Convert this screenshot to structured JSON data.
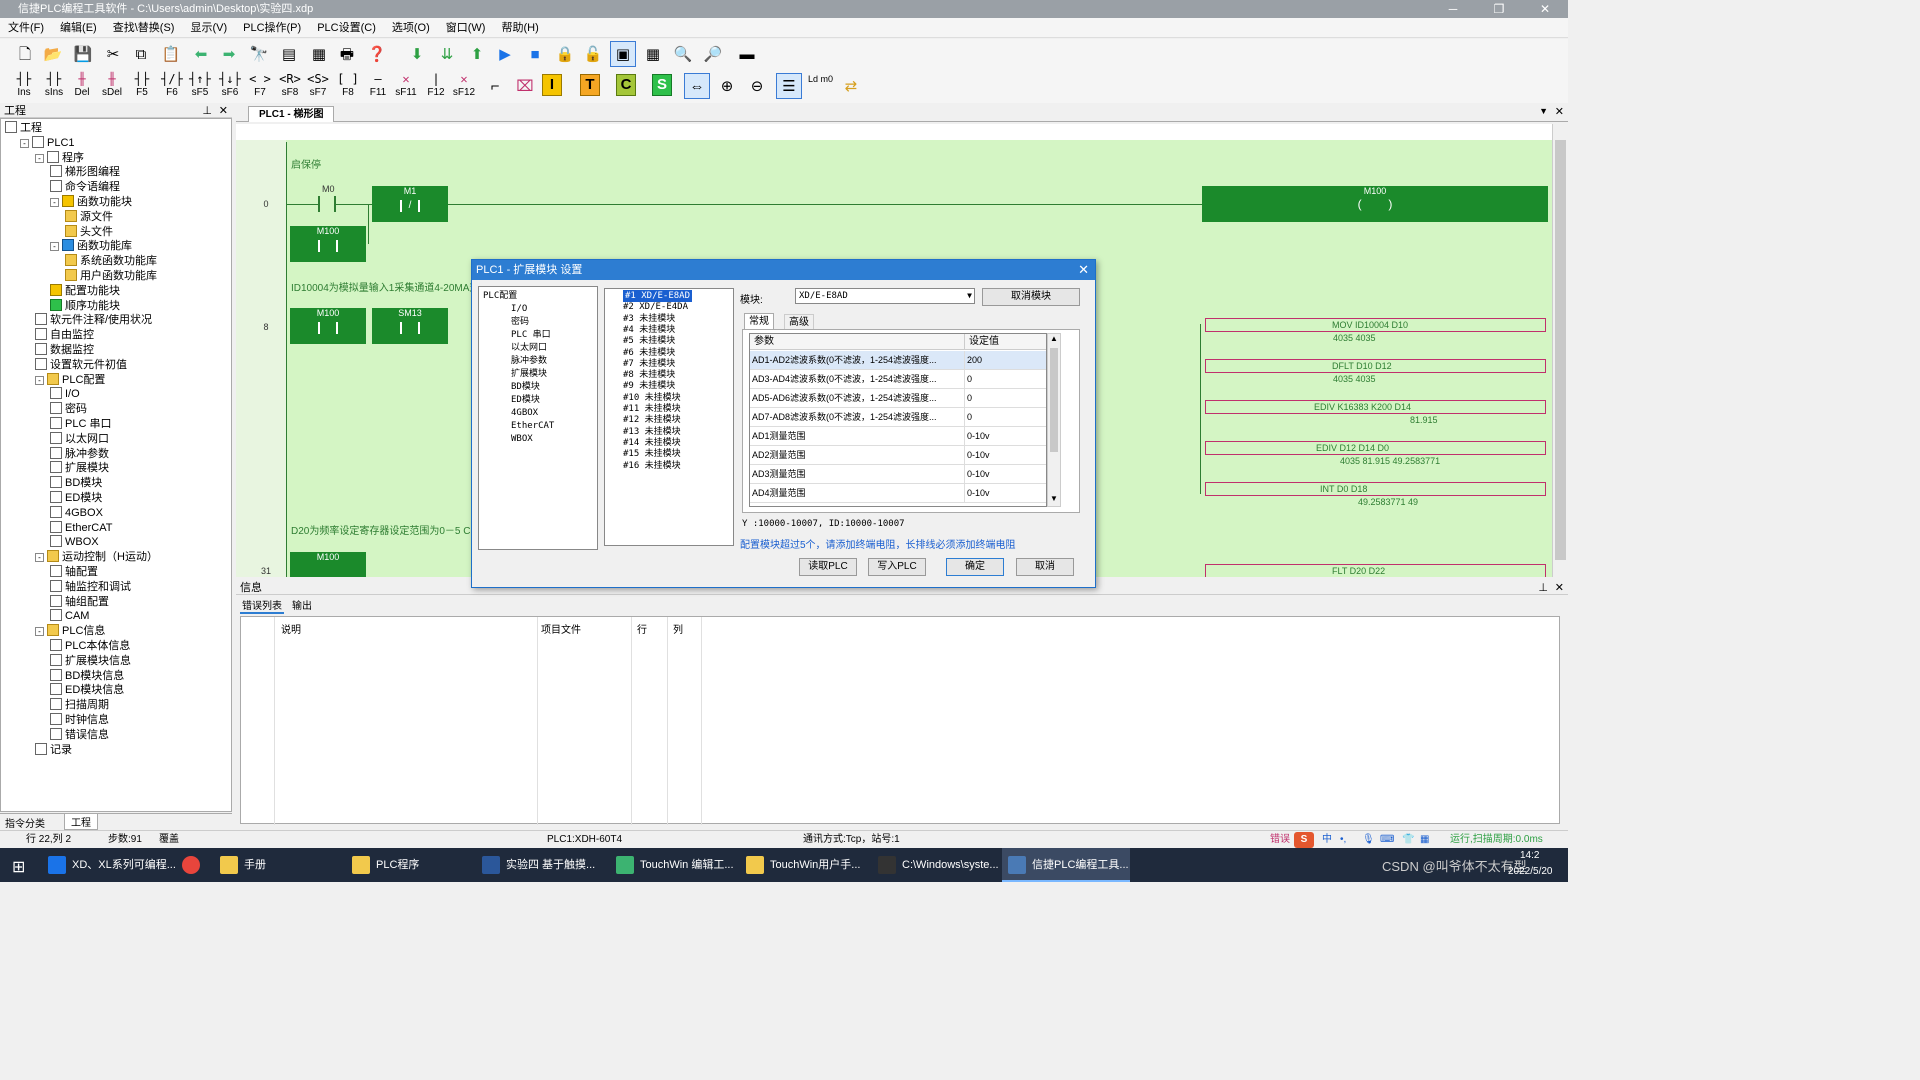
{
  "window": {
    "title": "信捷PLC编程工具软件 - C:\\Users\\admin\\Desktop\\实验四.xdp"
  },
  "menu": [
    "文件(F)",
    "编辑(E)",
    "查找\\替换(S)",
    "显示(V)",
    "PLC操作(P)",
    "PLC设置(C)",
    "选项(O)",
    "窗口(W)",
    "帮助(H)"
  ],
  "ladder_toolbar": [
    {
      "glyph": "┤├",
      "key": "Ins"
    },
    {
      "glyph": "┤├",
      "key": "sIns"
    },
    {
      "glyph": "╫",
      "key": "Del"
    },
    {
      "glyph": "╫",
      "key": "sDel"
    },
    {
      "glyph": "┤├",
      "key": "F5"
    },
    {
      "glyph": "┤/├",
      "key": "F6"
    },
    {
      "glyph": "┤↑├",
      "key": "sF5"
    },
    {
      "glyph": "┤↓├",
      "key": "sF6"
    },
    {
      "glyph": "< >",
      "key": "F7"
    },
    {
      "glyph": "<R>",
      "key": "sF8"
    },
    {
      "glyph": "<S>",
      "key": "sF7"
    },
    {
      "glyph": "[ ]",
      "key": "F8"
    },
    {
      "glyph": "—",
      "key": "F11"
    },
    {
      "glyph": "✕",
      "key": "sF11"
    },
    {
      "glyph": "|",
      "key": "F12"
    },
    {
      "glyph": "✕",
      "key": "sF12"
    }
  ],
  "ladder_toolbar_extra": {
    "ldm": "Ld m0"
  },
  "project_panel": {
    "header": "工程",
    "tree": [
      {
        "label": "工程",
        "level": 0,
        "icon": "project"
      },
      {
        "label": "PLC1",
        "level": 1,
        "icon": "plc",
        "exp": "-"
      },
      {
        "label": "程序",
        "level": 2,
        "icon": "program",
        "exp": "-"
      },
      {
        "label": "梯形图编程",
        "level": 3,
        "icon": "ladder"
      },
      {
        "label": "命令语编程",
        "level": 3,
        "icon": "cmd"
      },
      {
        "label": "函数功能块",
        "level": 3,
        "icon": "yel",
        "exp": "-"
      },
      {
        "label": "源文件",
        "level": 4,
        "icon": "folder"
      },
      {
        "label": "头文件",
        "level": 4,
        "icon": "folder"
      },
      {
        "label": "函数功能库",
        "level": 3,
        "icon": "blue",
        "exp": "-"
      },
      {
        "label": "系统函数功能库",
        "level": 4,
        "icon": "folder"
      },
      {
        "label": "用户函数功能库",
        "level": 4,
        "icon": "folder"
      },
      {
        "label": "配置功能块",
        "level": 3,
        "icon": "yel"
      },
      {
        "label": "顺序功能块",
        "level": 3,
        "icon": "grn"
      },
      {
        "label": "软元件注释/使用状况",
        "level": 2,
        "icon": "doc"
      },
      {
        "label": "自由监控",
        "level": 2,
        "icon": "doc"
      },
      {
        "label": "数据监控",
        "level": 2,
        "icon": "doc"
      },
      {
        "label": "设置软元件初值",
        "level": 2,
        "icon": "doc"
      },
      {
        "label": "PLC配置",
        "level": 2,
        "icon": "folder",
        "exp": "-"
      },
      {
        "label": "I/O",
        "level": 3,
        "icon": "io"
      },
      {
        "label": "密码",
        "level": 3,
        "icon": "doc"
      },
      {
        "label": "PLC 串口",
        "level": 3,
        "icon": "doc"
      },
      {
        "label": "以太网口",
        "level": 3,
        "icon": "doc"
      },
      {
        "label": "脉冲参数",
        "level": 3,
        "icon": "doc"
      },
      {
        "label": "扩展模块",
        "level": 3,
        "icon": "doc"
      },
      {
        "label": "BD模块",
        "level": 3,
        "icon": "doc"
      },
      {
        "label": "ED模块",
        "level": 3,
        "icon": "doc"
      },
      {
        "label": "4GBOX",
        "level": 3,
        "icon": "doc"
      },
      {
        "label": "EtherCAT",
        "level": 3,
        "icon": "doc"
      },
      {
        "label": "WBOX",
        "level": 3,
        "icon": "doc"
      },
      {
        "label": "运动控制（H运动）",
        "level": 2,
        "icon": "folder",
        "exp": "-"
      },
      {
        "label": "轴配置",
        "level": 3,
        "icon": "doc"
      },
      {
        "label": "轴监控和调试",
        "level": 3,
        "icon": "doc"
      },
      {
        "label": "轴组配置",
        "level": 3,
        "icon": "doc"
      },
      {
        "label": "CAM",
        "level": 3,
        "icon": "doc"
      },
      {
        "label": "PLC信息",
        "level": 2,
        "icon": "folder",
        "exp": "-"
      },
      {
        "label": "PLC本体信息",
        "level": 3,
        "icon": "doc"
      },
      {
        "label": "扩展模块信息",
        "level": 3,
        "icon": "doc"
      },
      {
        "label": "BD模块信息",
        "level": 3,
        "icon": "doc"
      },
      {
        "label": "ED模块信息",
        "level": 3,
        "icon": "doc"
      },
      {
        "label": "扫描周期",
        "level": 3,
        "icon": "doc"
      },
      {
        "label": "时钟信息",
        "level": 3,
        "icon": "doc"
      },
      {
        "label": "错误信息",
        "level": 3,
        "icon": "doc"
      },
      {
        "label": "记录",
        "level": 2,
        "icon": "doc"
      }
    ],
    "bottom_tabs": [
      "指令分类",
      "工程"
    ]
  },
  "editor_tab": "PLC1 - 梯形图",
  "ladder": {
    "comment1": "启保停",
    "comment2": "ID10004为模拟量输入1采集通道4-20MA对",
    "comment3": "D20为频率设定寄存器设定范围为0－5 C",
    "rungs": [
      "0",
      "8",
      "31"
    ],
    "contacts": {
      "m0": "M0",
      "m1": "M1",
      "m100a": "M100",
      "m100b": "M100",
      "sm13": "SM13",
      "m100c": "M100"
    },
    "coil": "M100",
    "fblocks": [
      {
        "label": "MOV      ID10004 D10",
        "vals": "4035        4035"
      },
      {
        "label": "DFLT    D10      D12",
        "vals": "4035        4035"
      },
      {
        "label": "EDIV      K16383  K200     D14",
        "vals": "81.915"
      },
      {
        "label": "EDIV      D12      D14     D0",
        "vals": "4035     81.915   49.2583771"
      },
      {
        "label": "INT       D0        D18",
        "vals": "49.2583771          49"
      },
      {
        "label": "FLT      D20      D22",
        "vals": ""
      }
    ]
  },
  "dialog": {
    "title": "PLC1 - 扩展模块  设置",
    "config_tree": [
      "PLC配置",
      "I/O",
      "密码",
      "PLC 串口",
      "以太网口",
      "脉冲参数",
      "扩展模块",
      "BD模块",
      "ED模块",
      "4GBOX",
      "EtherCAT",
      "WBOX"
    ],
    "modules": [
      "#1 XD/E-E8AD",
      "#2 XD/E-E4DA",
      "#3 未挂模块",
      "#4 未挂模块",
      "#5 未挂模块",
      "#6 未挂模块",
      "#7 未挂模块",
      "#8 未挂模块",
      "#9 未挂模块",
      "#10 未挂模块",
      "#11 未挂模块",
      "#12 未挂模块",
      "#13 未挂模块",
      "#14 未挂模块",
      "#15 未挂模块",
      "#16 未挂模块"
    ],
    "module_label": "模块:",
    "module_value": "XD/E-E8AD",
    "cancel_module": "取消模块",
    "tabs": [
      "常规",
      "高级"
    ],
    "grid_headers": [
      "参数",
      "设定值"
    ],
    "grid_rows": [
      [
        "AD1-AD2滤波系数(0不滤波，1-254滤波强度...",
        "200"
      ],
      [
        "AD3-AD4滤波系数(0不滤波，1-254滤波强度...",
        "0"
      ],
      [
        "AD5-AD6滤波系数(0不滤波，1-254滤波强度...",
        "0"
      ],
      [
        "AD7-AD8滤波系数(0不滤波，1-254滤波强度...",
        "0"
      ],
      [
        "AD1测量范围",
        "0-10v"
      ],
      [
        "AD2测量范围",
        "0-10v"
      ],
      [
        "AD3测量范围",
        "0-10v"
      ],
      [
        "AD4测量范围",
        "0-10v"
      ]
    ],
    "address_info": "Y :10000-10007, ID:10000-10007",
    "warning": "配置模块超过5个，请添加终端电阻，长排线必须添加终端电阻",
    "buttons": {
      "read": "读取PLC",
      "write": "写入PLC",
      "ok": "确定",
      "cancel": "取消"
    }
  },
  "info_panel": {
    "header": "信息",
    "tabs": [
      "错误列表",
      "输出"
    ],
    "columns": [
      "说明",
      "项目文件",
      "行",
      "列"
    ]
  },
  "status": {
    "position": "行 22,列 2",
    "steps": "步数:91",
    "mode": "覆盖",
    "plc": "PLC1:XDH-60T4",
    "comm": "通讯方式:Tcp，站号:1",
    "error": "错误",
    "run": "运行,扫描周期:0.0ms"
  },
  "taskbar": {
    "apps": [
      {
        "label": "XD、XL系列可编程...",
        "color": "#1a73e8"
      },
      {
        "label": "",
        "color": "#e8453c"
      },
      {
        "label": "手册",
        "color": "#f2c94c"
      },
      {
        "label": "PLC程序",
        "color": "#f2c94c"
      },
      {
        "label": "实验四  基于触摸...",
        "color": "#2b579a"
      },
      {
        "label": "TouchWin 编辑工...",
        "color": "#3cb371"
      },
      {
        "label": "TouchWin用户手...",
        "color": "#f2c94c"
      },
      {
        "label": "C:\\Windows\\syste...",
        "color": "#333333"
      },
      {
        "label": "信捷PLC编程工具...",
        "color": "#4a7ab5"
      }
    ],
    "clock_time": "14:2",
    "clock_date": "2022/5/20",
    "ime": "中",
    "watermark": "CSDN @叫爷体不太有型"
  }
}
